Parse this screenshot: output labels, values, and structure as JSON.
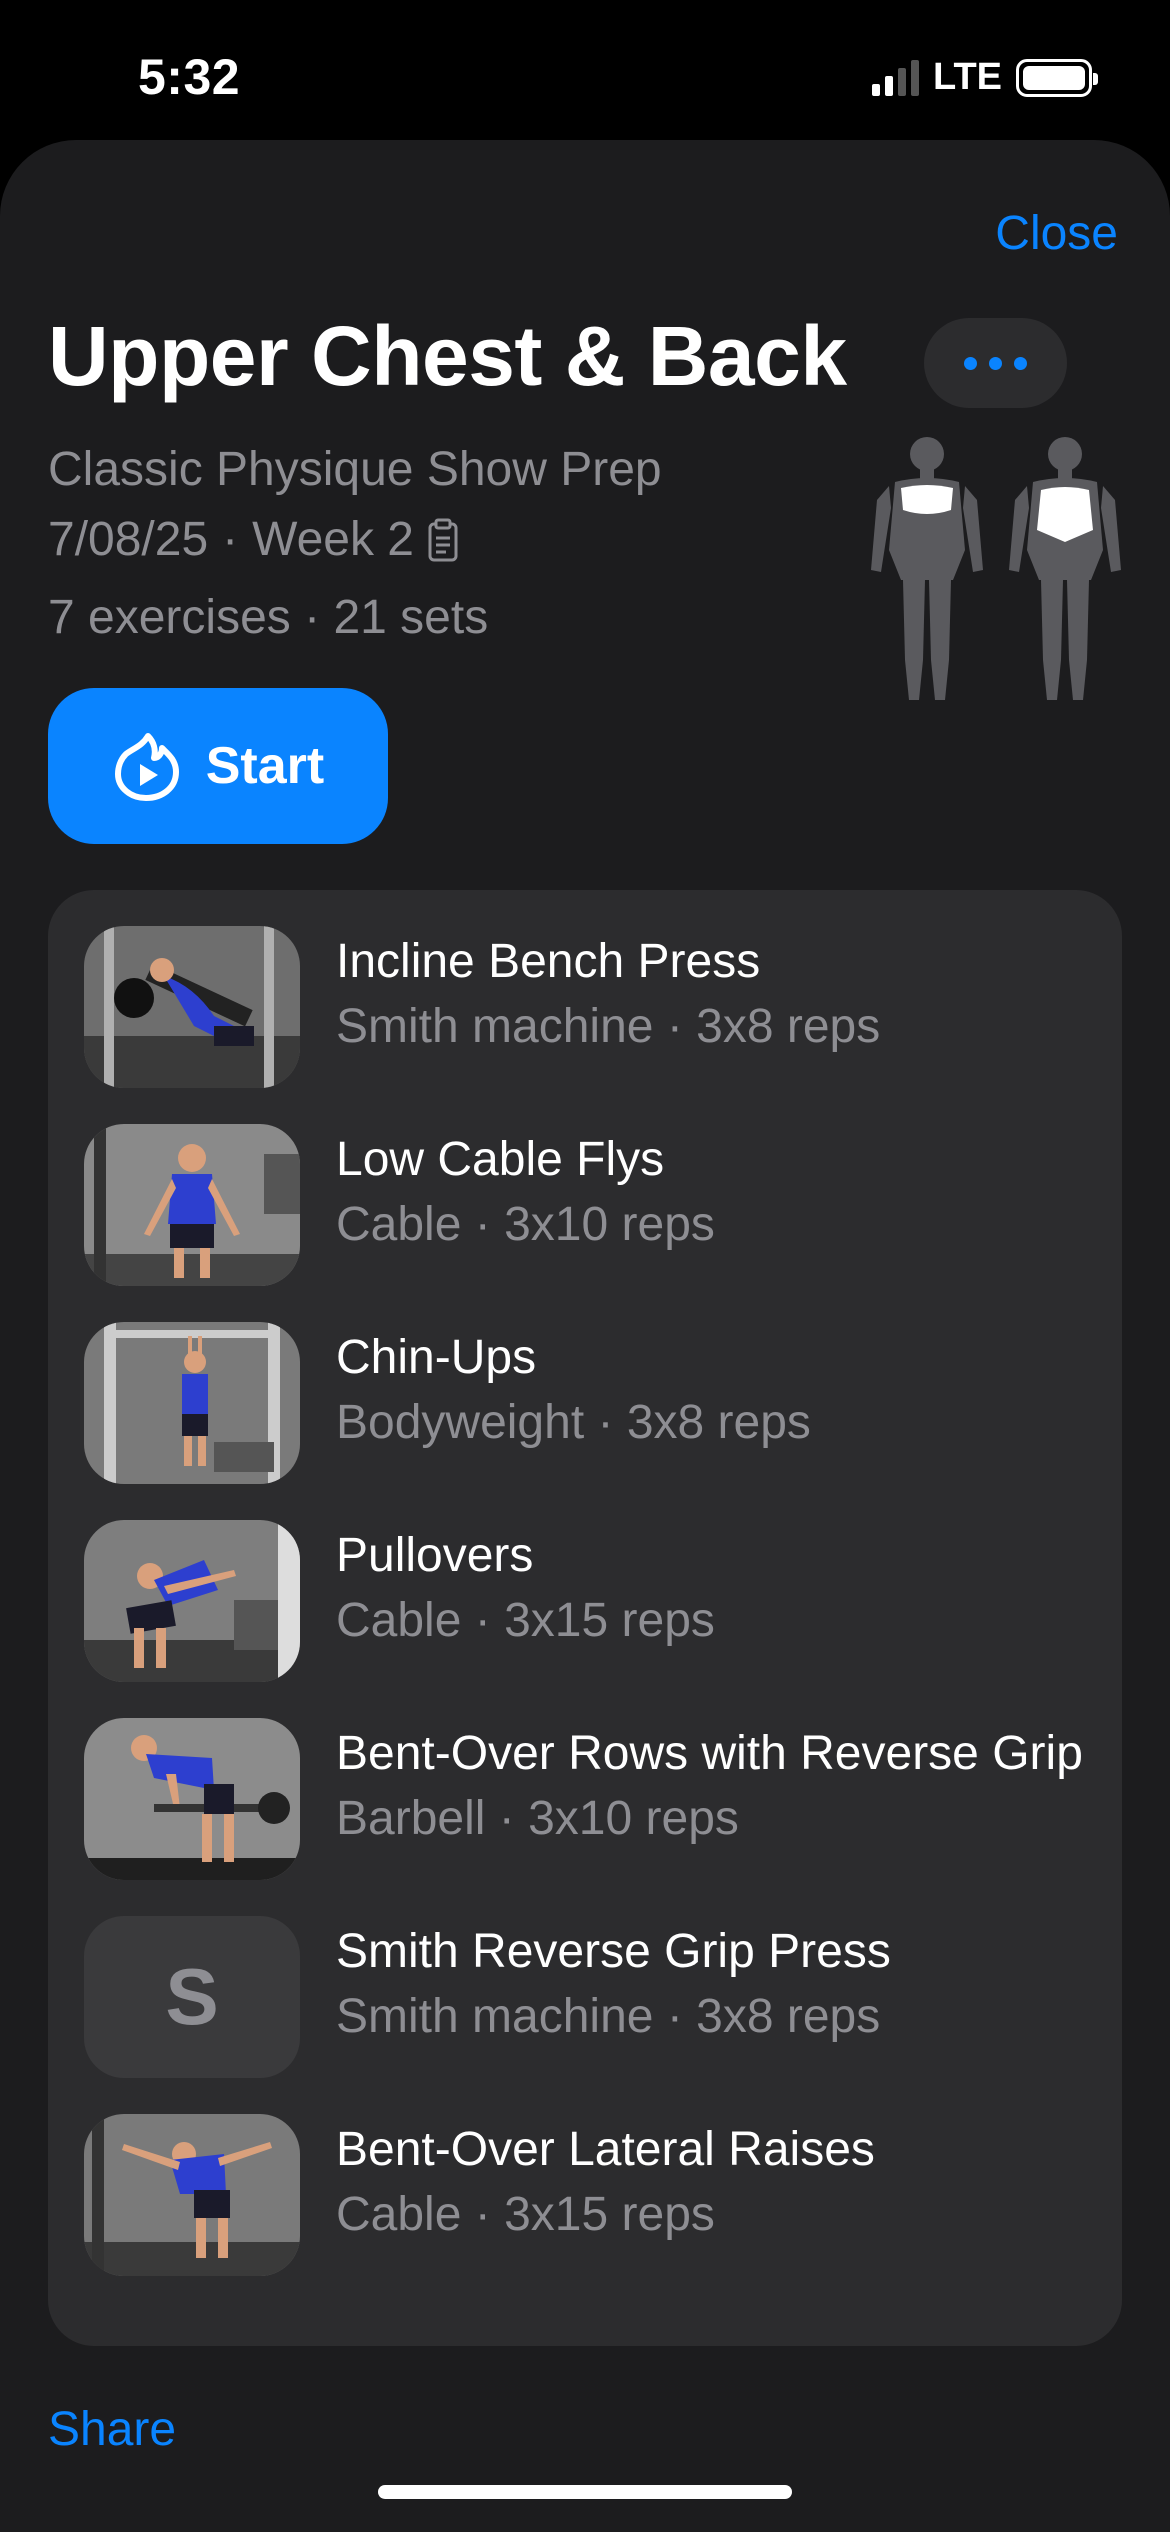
{
  "status_bar": {
    "time": "5:32",
    "network": "LTE"
  },
  "header": {
    "close_label": "Close",
    "title": "Upper Chest & Back",
    "more_icon": "ellipsis-icon"
  },
  "workout": {
    "program": "Classic Physique Show Prep",
    "date": "7/08/25",
    "week": "Week 2",
    "separator": "·",
    "exercise_count": "7 exercises",
    "set_count": "21 sets"
  },
  "start_button": {
    "label": "Start",
    "icon": "play-flame-icon"
  },
  "exercises": [
    {
      "name": "Incline Bench Press",
      "equipment": "Smith machine",
      "scheme": "3x8 reps"
    },
    {
      "name": "Low Cable Flys",
      "equipment": "Cable",
      "scheme": "3x10 reps"
    },
    {
      "name": "Chin-Ups",
      "equipment": "Bodyweight",
      "scheme": "3x8 reps"
    },
    {
      "name": "Pullovers",
      "equipment": "Cable",
      "scheme": "3x15 reps"
    },
    {
      "name": "Bent-Over Rows with Reverse Grip",
      "equipment": "Barbell",
      "scheme": "3x10 reps"
    },
    {
      "name": "Smith Reverse Grip Press",
      "equipment": "Smith machine",
      "scheme": "3x8 reps",
      "placeholder_letter": "S"
    },
    {
      "name": "Bent-Over Lateral Raises",
      "equipment": "Cable",
      "scheme": "3x15 reps"
    }
  ],
  "footer": {
    "share_label": "Share"
  },
  "colors": {
    "accent": "#0a84ff",
    "sheet_bg": "#1c1c1e",
    "card_bg": "#2c2c2e",
    "secondary_text": "#8e8e93"
  }
}
